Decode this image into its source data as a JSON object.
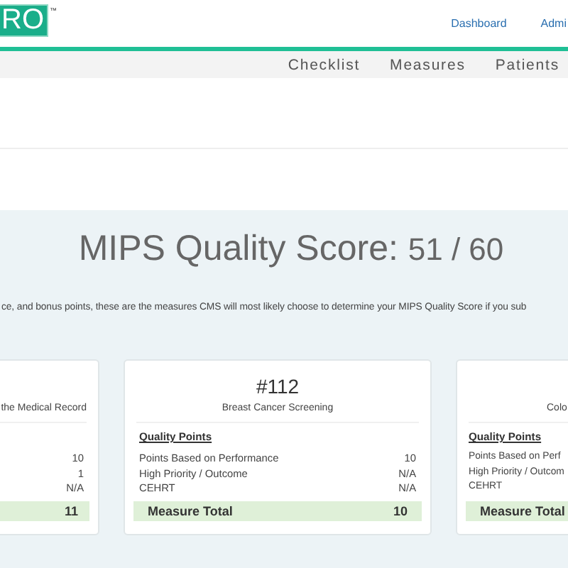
{
  "header": {
    "logo_text": "RO",
    "trademark": "™",
    "links": [
      "Dashboard",
      "Admi"
    ]
  },
  "nav": {
    "items": [
      {
        "label": "Checklist",
        "selected": false
      },
      {
        "label": "Measures",
        "selected": false
      },
      {
        "label": "Patients",
        "selected": false
      }
    ]
  },
  "score": {
    "title": "MIPS Quality Score:",
    "value": "51 / 60"
  },
  "description": "ce, and bonus points, these are the measures CMS will most likely choose to determine your MIPS Quality Score if you sub",
  "cards": [
    {
      "subtitle": "the Medical Record",
      "rows": [
        {
          "value": "10"
        },
        {
          "value": "1"
        },
        {
          "value": "N/A"
        }
      ],
      "total": "11"
    },
    {
      "title": "#112",
      "subtitle": "Breast Cancer Screening",
      "heading": "Quality Points",
      "rows": [
        {
          "label": "Points Based on Performance",
          "value": "10"
        },
        {
          "label": "High Priority / Outcome",
          "value": "N/A"
        },
        {
          "label": "CEHRT",
          "value": "N/A"
        }
      ],
      "total_label": "Measure Total",
      "total": "10"
    },
    {
      "subtitle": "Colo",
      "heading": "Quality Points",
      "rows": [
        {
          "label": "Points Based on Perf"
        },
        {
          "label": "High Priority / Outcom"
        },
        {
          "label": "CEHRT"
        }
      ],
      "total_label": "Measure Total"
    }
  ]
}
